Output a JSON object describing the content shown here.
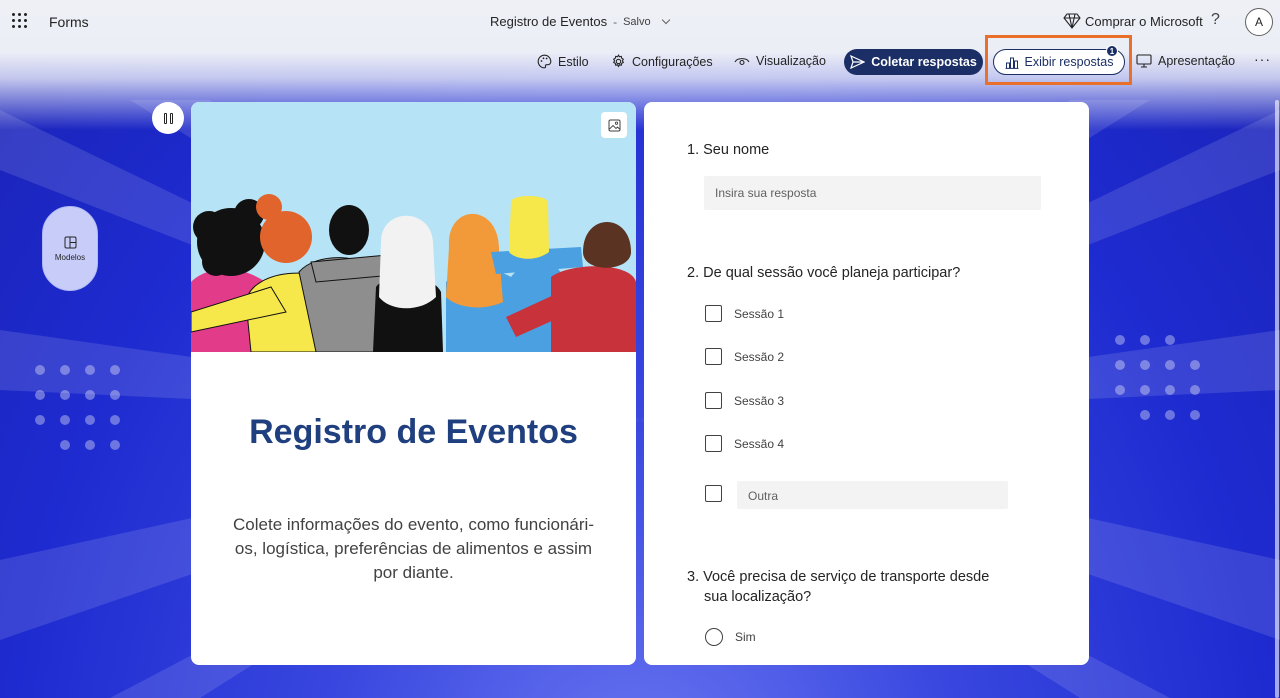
{
  "app": {
    "name": "Forms"
  },
  "document": {
    "title": "Registro de Eventos",
    "separator": "-",
    "save_status": "Salvo"
  },
  "header": {
    "buy_label": "Comprar o Microsoft",
    "help_label": "?",
    "avatar_initial": "A"
  },
  "toolbar": {
    "style_label": "Estilo",
    "settings_label": "Configurações",
    "preview_label": "Visualização",
    "collect_label": "Coletar respostas",
    "view_responses_label": "Exibir respostas",
    "responses_badge": "1",
    "present_label": "Apresentação",
    "more_label": "···"
  },
  "side": {
    "templates_label": "Modelos"
  },
  "cover": {
    "title": "Registro de Eventos",
    "description_line1": "Colete informações do evento, como funcionári-",
    "description_line2": "os, logística, preferências de alimentos e assim",
    "description_line3": "por diante."
  },
  "form": {
    "q1": {
      "number": "1.",
      "text": "Seu nome",
      "placeholder": "Insira sua resposta"
    },
    "q2": {
      "number": "2.",
      "text": "De qual sessão você planeja participar?",
      "options": [
        "Sessão 1",
        "Sessão 2",
        "Sessão 3",
        "Sessão 4"
      ],
      "other_placeholder": "Outra"
    },
    "q3": {
      "number": "3.",
      "text_line1": "Você precisa de serviço de transporte desde",
      "text_line2": "sua localização?",
      "options": [
        "Sim"
      ]
    }
  },
  "colors": {
    "accent": "#1b2f66",
    "title": "#1f3f7f",
    "highlight": "#e8702a",
    "background": "#1e2bd0"
  }
}
